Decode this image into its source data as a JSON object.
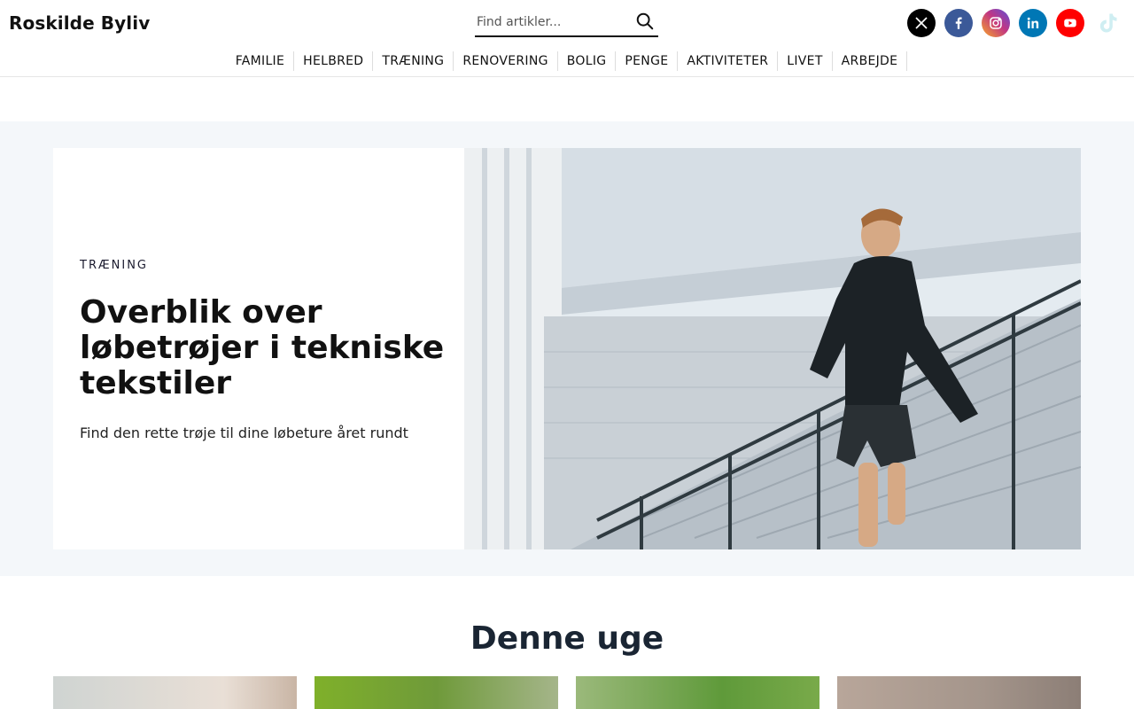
{
  "site": {
    "name": "Roskilde Byliv"
  },
  "search": {
    "placeholder": "Find artikler..."
  },
  "socials": [
    {
      "name": "X",
      "color": "#000000"
    },
    {
      "name": "Facebook",
      "color": "#3b5998"
    },
    {
      "name": "Instagram",
      "color": "#c13584"
    },
    {
      "name": "LinkedIn",
      "color": "#0077b5"
    },
    {
      "name": "YouTube",
      "color": "#ff0000"
    },
    {
      "name": "TikTok",
      "color": "#d9f1f4"
    }
  ],
  "nav": [
    "FAMILIE",
    "HELBRED",
    "TRÆNING",
    "RENOVERING",
    "BOLIG",
    "PENGE",
    "AKTIVITETER",
    "LIVET",
    "ARBEJDE"
  ],
  "hero": {
    "category": "TRÆNING",
    "title": "Overblik over løbetrøjer i tekniske tekstiler",
    "subtitle": "Find den rette trøje til dine løbeture året rundt"
  },
  "week": {
    "title": "Denne uge"
  }
}
